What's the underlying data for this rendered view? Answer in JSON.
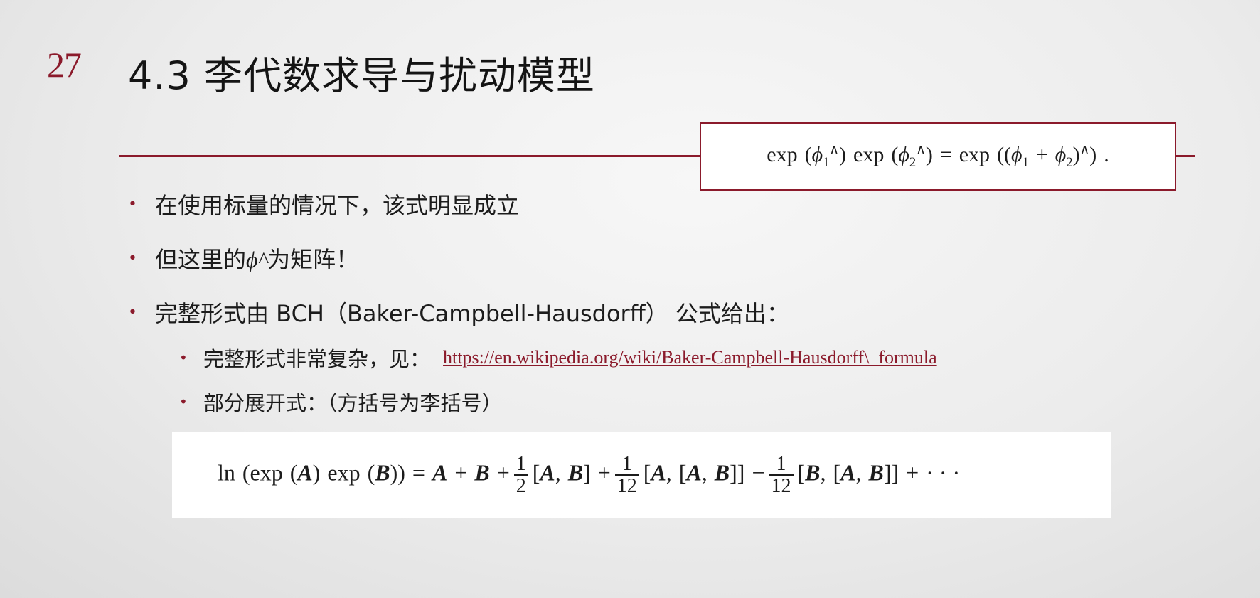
{
  "slide": {
    "number": "27",
    "title": "4.3 李代数求导与扰动模型"
  },
  "formula_box": {
    "latex": "exp(φ1^) exp(φ2^) = exp((φ1 + φ2)^) ."
  },
  "bullets": [
    {
      "text": "在使用标量的情况下，该式明显成立"
    },
    {
      "prefix": "但这里的",
      "symbol": "ϕ^",
      "suffix": "为矩阵！"
    },
    {
      "text": "完整形式由 BCH（Baker-Campbell-Hausdorff） 公式给出："
    }
  ],
  "sub_bullets": [
    {
      "text": "完整形式非常复杂，见：",
      "link": "https://en.wikipedia.org/wiki/Baker-Campbell-Hausdorff\\_formula"
    },
    {
      "text": "部分展开式：（方括号为李括号）"
    }
  ],
  "bch_formula": {
    "latex": "ln(exp(A) exp(B)) = A + B + 1/2 [A,B] + 1/12 [A,[A,B]] − 1/12 [B,[A,B]] + ···"
  },
  "colors": {
    "accent": "#8b1a2b",
    "text": "#1c1c1c"
  }
}
